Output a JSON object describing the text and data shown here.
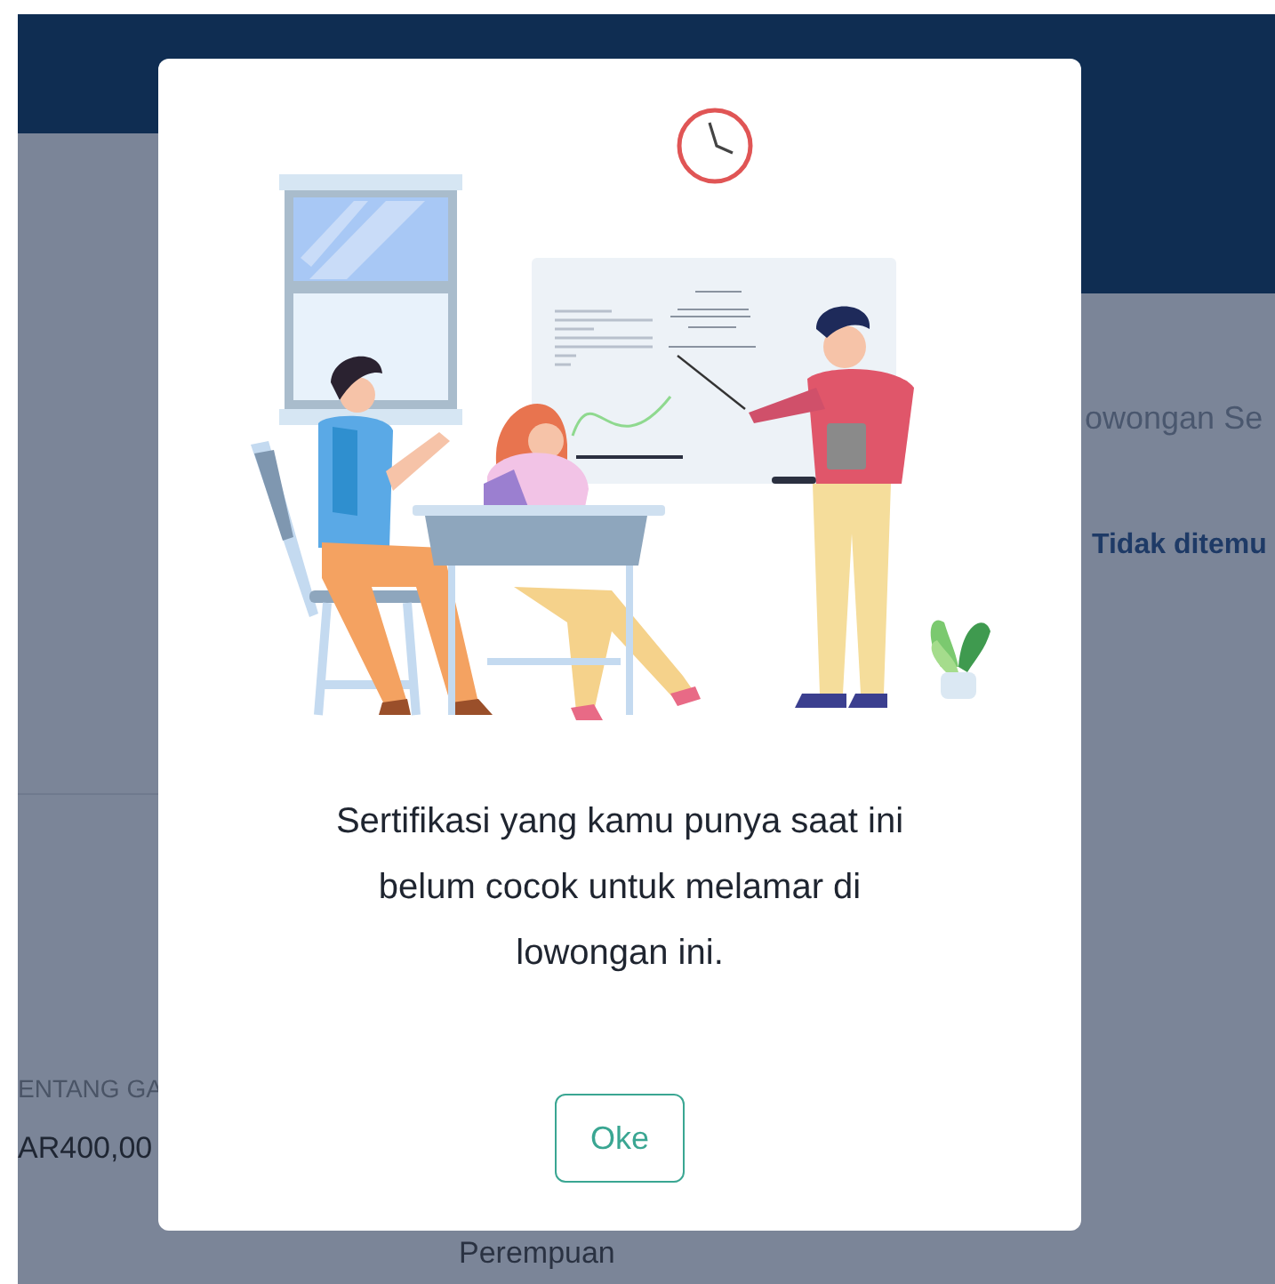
{
  "background": {
    "right_panel": {
      "heading": "owongan Se",
      "message": "Tidak ditemu"
    },
    "salary": {
      "label": "ENTANG GA",
      "value": "AR400,00"
    },
    "quota": {
      "text": "Perempuan"
    }
  },
  "dialog": {
    "message": "Sertifikasi yang kamu punya saat ini belum cocok untuk melamar di lowongan ini.",
    "button": "Oke"
  }
}
